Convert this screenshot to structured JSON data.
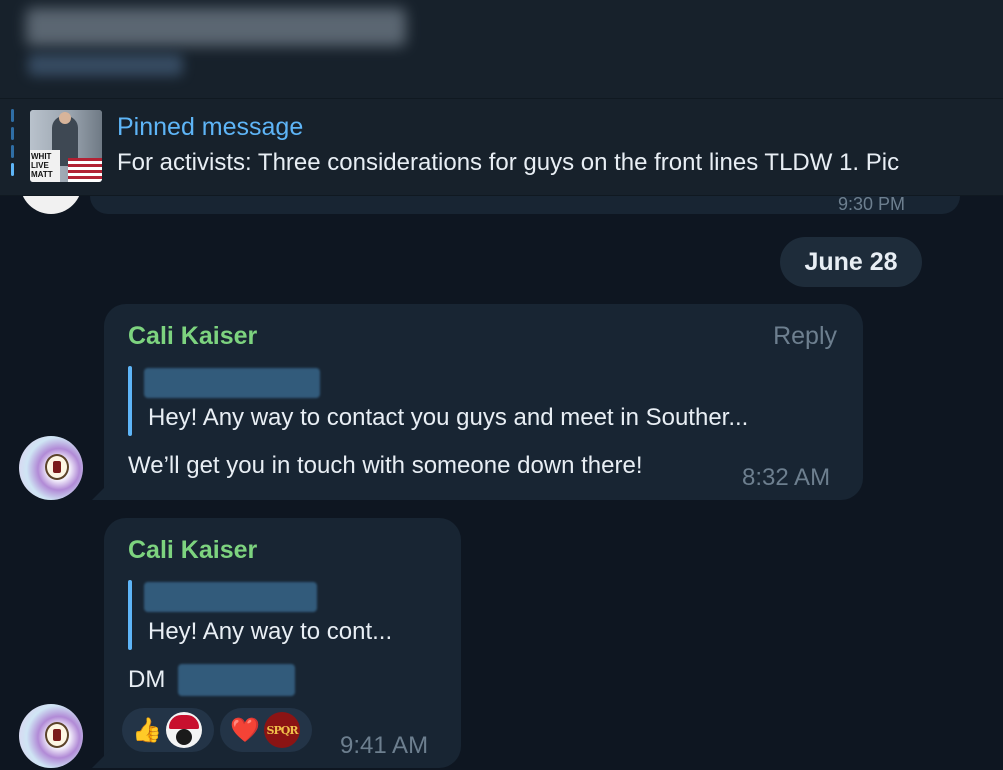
{
  "header": {
    "title_redacted": true,
    "subtitle_redacted": true
  },
  "pinned": {
    "title": "Pinned message",
    "text": "For activists: Three considerations for guys on the front lines  TLDW 1.  Pic",
    "thumbnail_sign_text": "WHIT LIVE MATT"
  },
  "previous_message": {
    "time": "9:30 PM"
  },
  "date_divider": {
    "label": "June 28"
  },
  "messages": [
    {
      "sender": "Cali Kaiser",
      "reply_label": "Reply",
      "quote_author_redacted": true,
      "quote_text": "Hey! Any way to contact you guys and meet in Souther...",
      "text": "We’ll get you in touch with someone down there!",
      "time": "8:32 AM"
    },
    {
      "sender": "Cali Kaiser",
      "quote_author_redacted": true,
      "quote_text": "Hey! Any way to cont...",
      "text": "DM",
      "time": "9:41 AM",
      "reactions": [
        {
          "emoji": "👍",
          "icon": "thumbs-up-icon",
          "user_avatar": "masked-user-avatar"
        },
        {
          "emoji": "❤️",
          "icon": "heart-icon",
          "user_avatar": "spqr-avatar",
          "user_avatar_text": "SPQR"
        }
      ]
    }
  ],
  "colors": {
    "background": "#0e1621",
    "bubble": "#182533",
    "accent_blue": "#5eb5f7",
    "sender_green": "#7dd37f",
    "muted": "#6d7f8f"
  }
}
